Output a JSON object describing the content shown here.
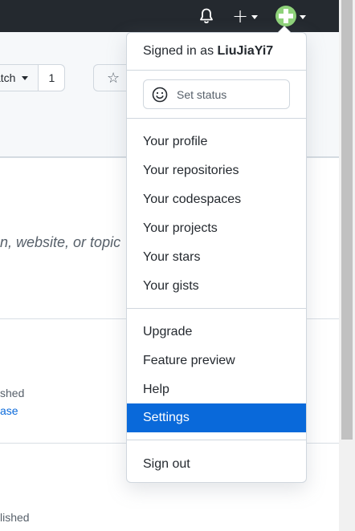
{
  "header": {
    "bell_icon": "bell-icon",
    "plus_icon": "plus-icon",
    "plus_glyph": "+",
    "avatar_icon": "avatar-icon"
  },
  "repo": {
    "watch_label": "atch",
    "watch_count": "1",
    "star_icon": "star-icon",
    "star_glyph": "☆",
    "about_text": "n, website, or topic",
    "release_1_status": "shed",
    "release_1_link": "ase",
    "release_2_status": "lished"
  },
  "menu": {
    "signed_in_prefix": "Signed in as",
    "username": "LiuJiaYi7",
    "set_status": "Set status",
    "items": [
      {
        "label": "Your profile"
      },
      {
        "label": "Your repositories"
      },
      {
        "label": "Your codespaces"
      },
      {
        "label": "Your projects"
      },
      {
        "label": "Your stars"
      },
      {
        "label": "Your gists"
      },
      {
        "label": "Upgrade"
      },
      {
        "label": "Feature preview"
      },
      {
        "label": "Help"
      },
      {
        "label": "Settings",
        "active": true
      },
      {
        "label": "Sign out"
      }
    ]
  },
  "colors": {
    "header_bg": "#24292f",
    "active_item_bg": "#0969da",
    "link": "#0969da"
  }
}
